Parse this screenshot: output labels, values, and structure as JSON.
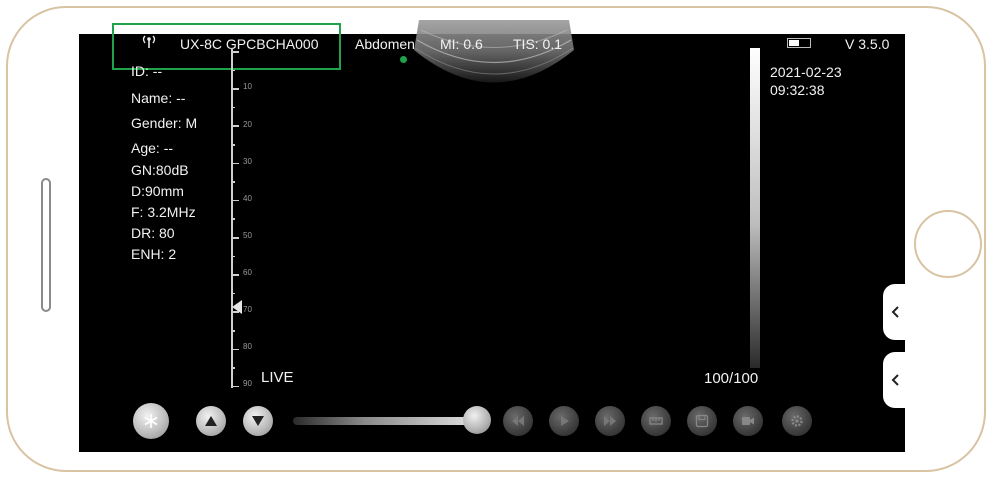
{
  "header": {
    "probe_model": "UX-8C GPCBCHA000",
    "preset": "Abdomen",
    "mi": "MI: 0.6",
    "tis": "TIS: 0.1",
    "version": "V 3.5.0",
    "date": "2021-02-23",
    "time": "09:32:38"
  },
  "patient_info": [
    "ID: --",
    "Name: --",
    "Gender: M",
    "Age: --",
    "GN:80dB",
    "D:90mm",
    "F: 3.2MHz",
    "DR: 80",
    "ENH: 2"
  ],
  "depth_scale": {
    "labels": [
      "10",
      "20",
      "30",
      "40",
      "50",
      "60",
      "70",
      "80",
      "90"
    ],
    "focus_depth": "70"
  },
  "status": {
    "live_label": "LIVE",
    "frame_counter": "100/100"
  },
  "colors": {
    "highlight": "#1ea34a",
    "preset_dot": "#1ea34a",
    "bezel": "#d8c3a2"
  },
  "controls": [
    {
      "icon": "snowflake-freeze-icon"
    },
    {
      "icon": "triangle-up-icon"
    },
    {
      "icon": "triangle-down-icon"
    },
    {
      "icon": "rewind-icon"
    },
    {
      "icon": "play-icon"
    },
    {
      "icon": "fast-forward-icon"
    },
    {
      "icon": "measure-icon"
    },
    {
      "icon": "save-icon"
    },
    {
      "icon": "video-record-icon"
    },
    {
      "icon": "settings-gear-icon"
    }
  ]
}
